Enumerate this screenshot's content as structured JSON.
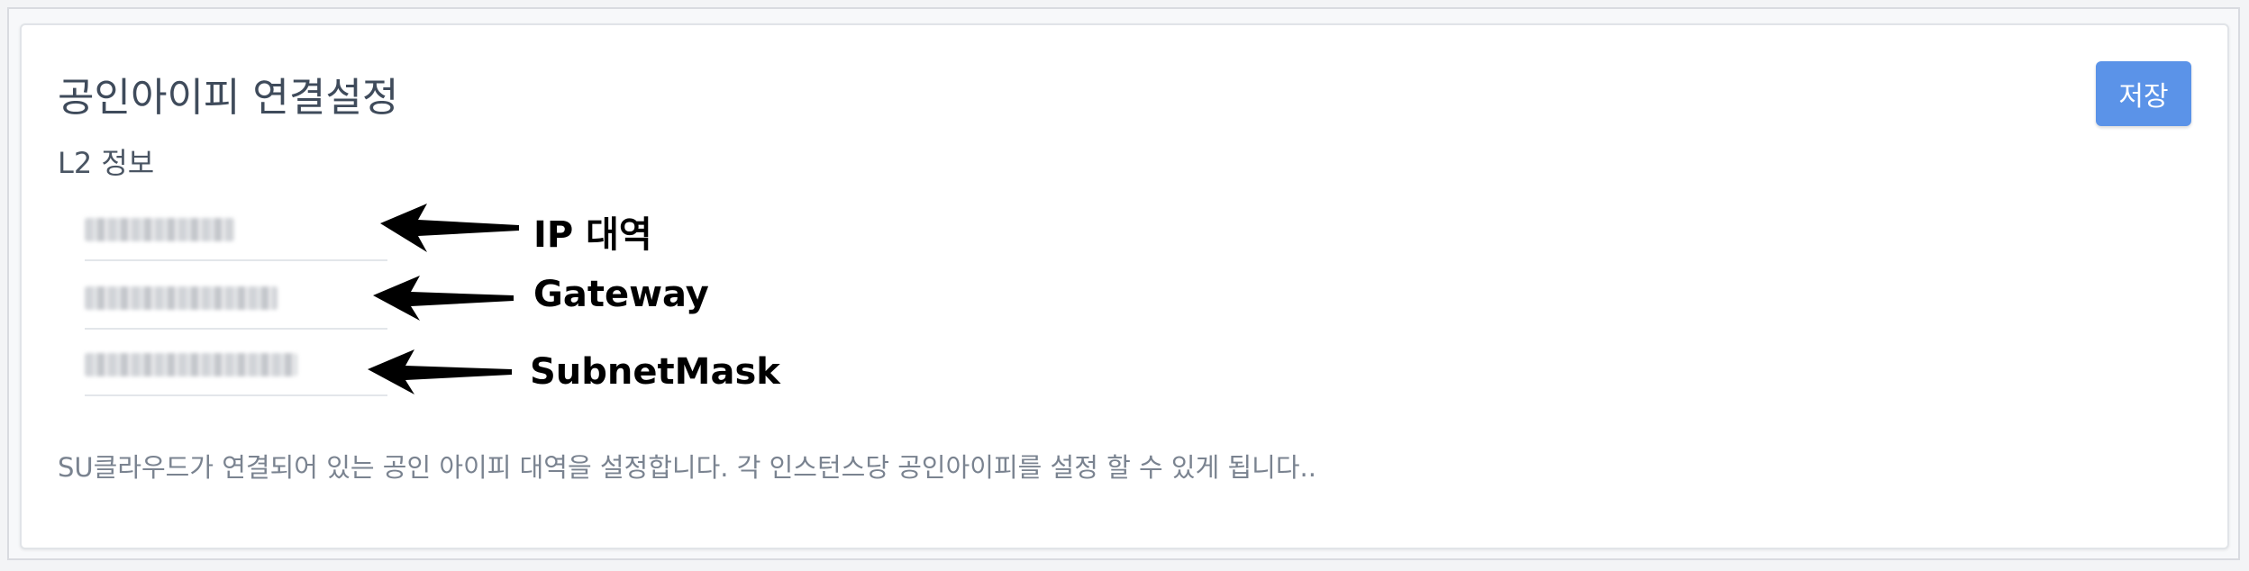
{
  "panel": {
    "title": "공인아이피 연결설정",
    "subtitle": "L2 정보",
    "save_label": "저장",
    "description": "SU클라우드가 연결되어 있는 공인 아이피 대역을 설정합니다. 각 인스턴스당 공인아이피를 설정 할 수 있게 됩니다.."
  },
  "fields": [
    {
      "name": "ip-range",
      "annotation": "IP 대역"
    },
    {
      "name": "gateway",
      "annotation": "Gateway"
    },
    {
      "name": "subnet-mask",
      "annotation": "SubnetMask"
    }
  ],
  "colors": {
    "accent": "#5b93e8",
    "title": "#3f4b5b",
    "description": "#7a8390"
  },
  "icons": [
    "arrow-left-icon"
  ]
}
